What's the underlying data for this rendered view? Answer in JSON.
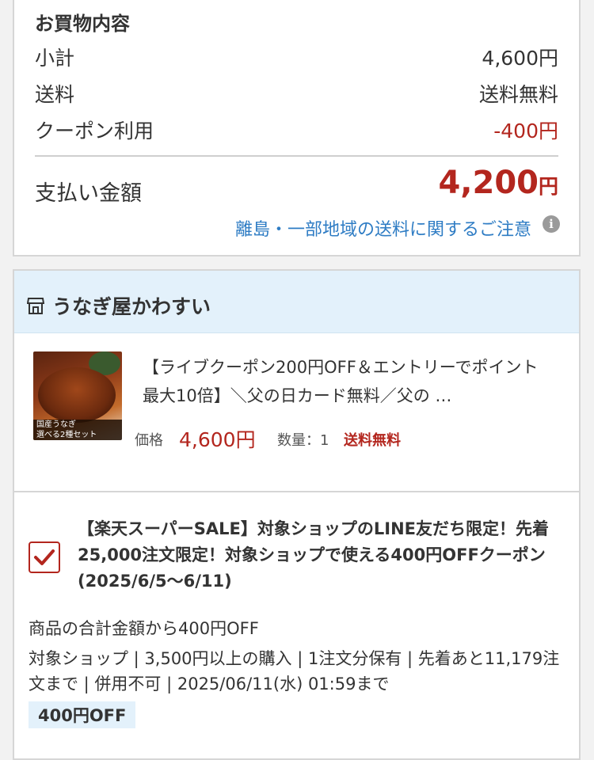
{
  "summary": {
    "title": "お買物内容",
    "subtotal_label": "小計",
    "subtotal_value": "4,600円",
    "shipping_label": "送料",
    "shipping_value": "送料無料",
    "coupon_label": "クーポン利用",
    "coupon_value": "-400円",
    "total_label": "支払い金額",
    "total_amount": "4,200",
    "total_unit": "円",
    "shipping_notice_link": "離島・一部地域の送料に関するご注意",
    "info_icon_glyph": "i"
  },
  "shop": {
    "name": "うなぎ屋かわすい",
    "product": {
      "image_caption_line1": "国産うなぎ",
      "image_caption_line2": "選べる2種セット",
      "title": "【ライブクーポン200円OFF＆エントリーでポイント最大10倍】＼父の日カード無料／父の …",
      "price_label": "価格",
      "price_value": "4,600円",
      "quantity_text": "数量：1",
      "shipping_badge": "送料無料"
    }
  },
  "coupon": {
    "checked": true,
    "title": "【楽天スーパーSALE】対象ショップのLINE友だち限定！先着25,000注文限定！対象ショップで使える400円OFFクーポン(2025/6/5〜6/11)",
    "description": "商品の合計金額から400円OFF",
    "conditions": "対象ショップ | 3,500円以上の購入 | 1注文分保有 | 先着あと11,179注文まで | 併用不可 | 2025/06/11(水) 01:59まで",
    "discount_badge": "400円OFF"
  },
  "colors": {
    "accent_red": "#b3261e",
    "link_blue": "#2e7cc4",
    "header_blue": "#e3f1fb"
  },
  "icons": [
    "shop-icon",
    "info-icon",
    "checkmark-icon"
  ]
}
